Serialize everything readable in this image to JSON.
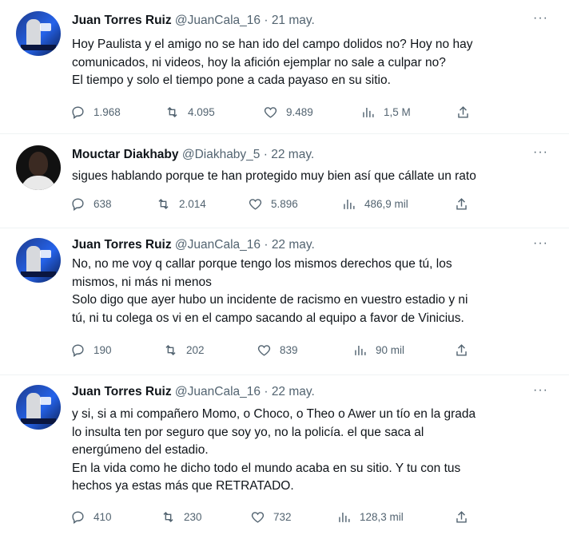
{
  "tweets": [
    {
      "name": "Juan Torres Ruiz",
      "handle": "@JuanCala_16",
      "sep": "·",
      "date": "21 may.",
      "lines": [
        "Hoy Paulista y el amigo no se han ido del campo dolidos no? Hoy no hay",
        "comunicados, ni videos, hoy la afición ejemplar no sale a culpar no?",
        "El tiempo y solo el tiempo pone a cada payaso en su sitio."
      ],
      "replies": "1.968",
      "retweets": "4.095",
      "likes": "9.489",
      "views": "1,5 M"
    },
    {
      "name": "Mouctar Diakhaby",
      "handle": "@Diakhaby_5",
      "sep": "·",
      "date": "22 may.",
      "lines": [
        "sigues hablando porque te han protegido muy bien así que cállate un rato"
      ],
      "replies": "638",
      "retweets": "2.014",
      "likes": "5.896",
      "views": "486,9 mil"
    },
    {
      "name": "Juan Torres Ruiz",
      "handle": "@JuanCala_16",
      "sep": "·",
      "date": "22 may.",
      "lines": [
        "No, no me voy q callar porque tengo los mismos derechos que tú, los",
        "mismos, ni más ni menos",
        "Solo digo que ayer hubo un incidente de racismo en vuestro estadio y ni",
        "tú, ni tu colega os vi en el campo sacando al equipo a favor de Vinicius."
      ],
      "replies": "190",
      "retweets": "202",
      "likes": "839",
      "views": "90 mil"
    },
    {
      "name": "Juan Torres Ruiz",
      "handle": "@JuanCala_16",
      "sep": "·",
      "date": "22 may.",
      "lines": [
        "y si, si a mi compañero Momo, o Choco, o Theo o Awer un tío en la grada",
        "lo insulta ten por seguro que soy yo, no la policía. el que saca al",
        "energúmeno del estadio.",
        "En la vida como he dicho todo el mundo acaba en su sitio. Y tu con tus",
        "hechos ya estas más que RETRATADO."
      ],
      "replies": "410",
      "retweets": "230",
      "likes": "732",
      "views": "128,3 mil"
    }
  ],
  "icons": {
    "more": "more-options-icon",
    "reply": "reply-icon",
    "retweet": "retweet-icon",
    "like": "like-icon",
    "views": "views-icon",
    "share": "share-icon"
  },
  "more_glyph": "···",
  "colors": {
    "text": "#0f1419",
    "secondary": "#536471",
    "divider": "#eff3f4"
  }
}
